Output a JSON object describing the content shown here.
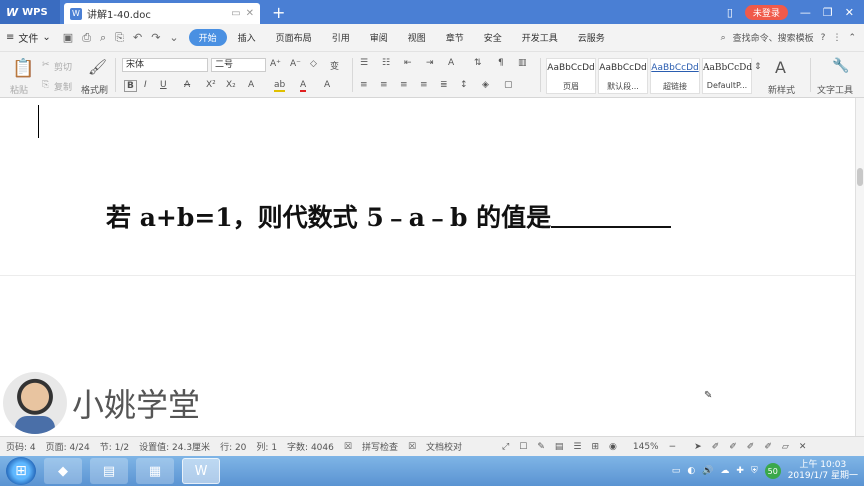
{
  "titlebar": {
    "app_name": "WPS",
    "doc_tab": "讲解1-40.doc",
    "login_label": "未登录"
  },
  "menubar": {
    "file_label": "文件",
    "items": [
      "开始",
      "插入",
      "页面布局",
      "引用",
      "审阅",
      "视图",
      "章节",
      "安全",
      "开发工具",
      "云服务"
    ],
    "active_item": "开始",
    "search_label": "查找命令、搜索模板"
  },
  "ribbon": {
    "paste_label": "粘贴",
    "cut_label": "剪切",
    "copy_label": "复制",
    "format_painter_label": "格式刷",
    "font_name": "宋体",
    "font_size": "二号",
    "styles": [
      {
        "preview": "AaBbCcDd",
        "name": "页眉"
      },
      {
        "preview": "AaBbCcDd",
        "name": "默认段..."
      },
      {
        "preview": "AaBbCcDd",
        "name": "超链接"
      },
      {
        "preview": "AaBbCcDd",
        "name": "DefaultP..."
      }
    ],
    "new_style_label": "新样式",
    "text_tool_label": "文字工具"
  },
  "document": {
    "question_text": "若 a+b=1，则代数式 5﹣a﹣b 的值是"
  },
  "watermark": {
    "brand_text": "小姚学堂"
  },
  "statusbar": {
    "page_num": "页码: 4",
    "pages": "页面: 4/24",
    "section": "节: 1/2",
    "position": "设置值: 24.3厘米",
    "row": "行: 20",
    "col": "列: 1",
    "word_count": "字数: 4046",
    "spell_check": "拼写检查",
    "doc_check": "文档校对",
    "zoom": "145%"
  },
  "taskbar": {
    "tray_badge": "50",
    "time": "上午 10:03",
    "date": "2019/1/7 星期一"
  }
}
